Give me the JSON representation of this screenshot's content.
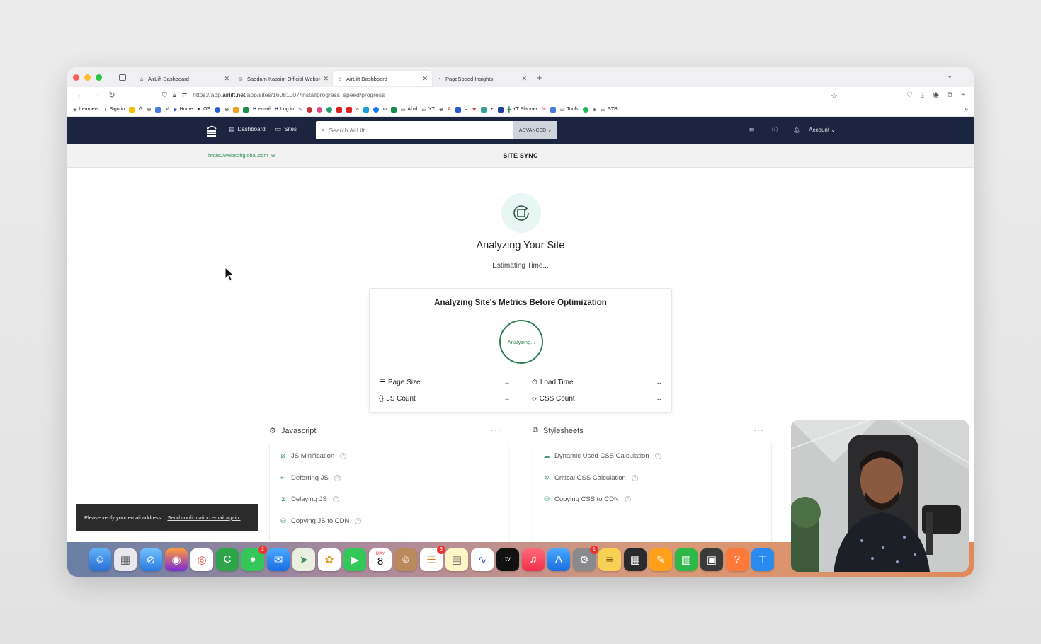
{
  "browser": {
    "tabs": [
      {
        "label": "AirLift Dashboard",
        "active": false
      },
      {
        "label": "Saddam Kassim Official Website",
        "active": false
      },
      {
        "label": "AirLift Dashboard",
        "active": true
      },
      {
        "label": "PageSpeed Insights",
        "active": false
      }
    ],
    "new_tab": "+",
    "url_prefix": "https://app.",
    "url_domain": "airlift.net",
    "url_path": "/app/sites/16081007/installprogress_speed/progress",
    "bookmarks": [
      "Learners",
      "Sign in",
      "Home",
      "iOS",
      "email",
      "Log in",
      "Abid",
      "YT",
      "YT Planner",
      "Tools",
      "STB"
    ]
  },
  "header": {
    "nav_dashboard": "Dashboard",
    "nav_sites": "Sites",
    "search_placeholder": "Search AirLift",
    "advanced": "ADVANCED",
    "account": "Account"
  },
  "subbar": {
    "site_url": "https://websoftglobal.com",
    "title": "SITE SYNC"
  },
  "main": {
    "heading": "Analyzing Your Site",
    "estimating": "Estimating Time...",
    "metrics_title": "Analyzing Site's Metrics Before Optimization",
    "ring_label": "Analyzing...",
    "metrics": [
      {
        "label": "Page Size",
        "value": "--"
      },
      {
        "label": "Load Time",
        "value": "--"
      },
      {
        "label": "JS Count",
        "value": "--"
      },
      {
        "label": "CSS Count",
        "value": "--"
      }
    ]
  },
  "javascript_panel": {
    "title": "Javascript",
    "items": [
      "JS Minification",
      "Deferring JS",
      "Delaying JS",
      "Copying JS to CDN"
    ]
  },
  "stylesheets_panel": {
    "title": "Stylesheets",
    "items": [
      "Dynamic Used CSS Calculation",
      "Critical CSS Calculation",
      "Copying CSS to CDN"
    ]
  },
  "toast": {
    "message": "Please verify your email address.",
    "link": "Send confirmation email again."
  },
  "dock": {
    "calendar_month": "MAY",
    "calendar_day": "8",
    "badge_messages": "2",
    "badge_reminders": "3",
    "badge_settings": "1",
    "tv_label": "tv"
  },
  "colors": {
    "header_bg": "#1b2540",
    "accent_green": "#2f7d57",
    "toast_bg": "#2b2b2b"
  }
}
